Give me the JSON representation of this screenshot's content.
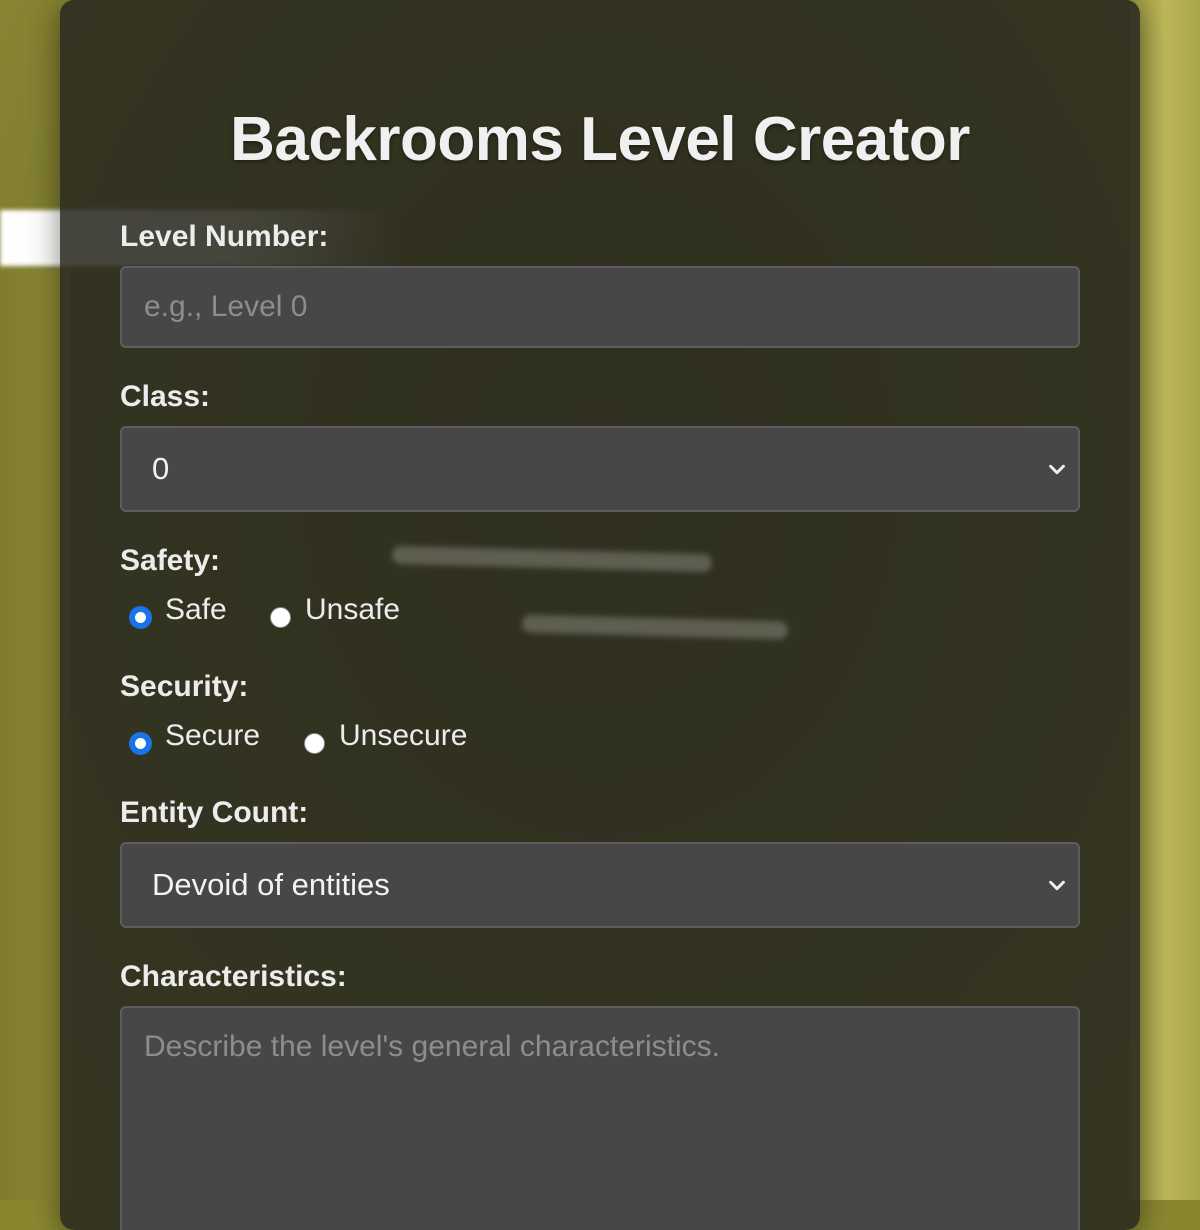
{
  "title": "Backrooms Level Creator",
  "level_number": {
    "label": "Level Number:",
    "placeholder": "e.g., Level 0",
    "value": ""
  },
  "class": {
    "label": "Class:",
    "selected": "0"
  },
  "safety": {
    "label": "Safety:",
    "options": [
      {
        "label": "Safe",
        "checked": true
      },
      {
        "label": "Unsafe",
        "checked": false
      }
    ]
  },
  "security": {
    "label": "Security:",
    "options": [
      {
        "label": "Secure",
        "checked": true
      },
      {
        "label": "Unsecure",
        "checked": false
      }
    ]
  },
  "entity_count": {
    "label": "Entity Count:",
    "selected": "Devoid of entities"
  },
  "characteristics": {
    "label": "Characteristics:",
    "placeholder": "Describe the level's general characteristics.",
    "value": ""
  },
  "colors": {
    "accent": "#1a73e8",
    "panel": "#28281f",
    "field": "#474747"
  },
  "icons": {
    "select_arrow": "chevron-down-icon",
    "textarea_grip": "resize-grip-icon"
  }
}
